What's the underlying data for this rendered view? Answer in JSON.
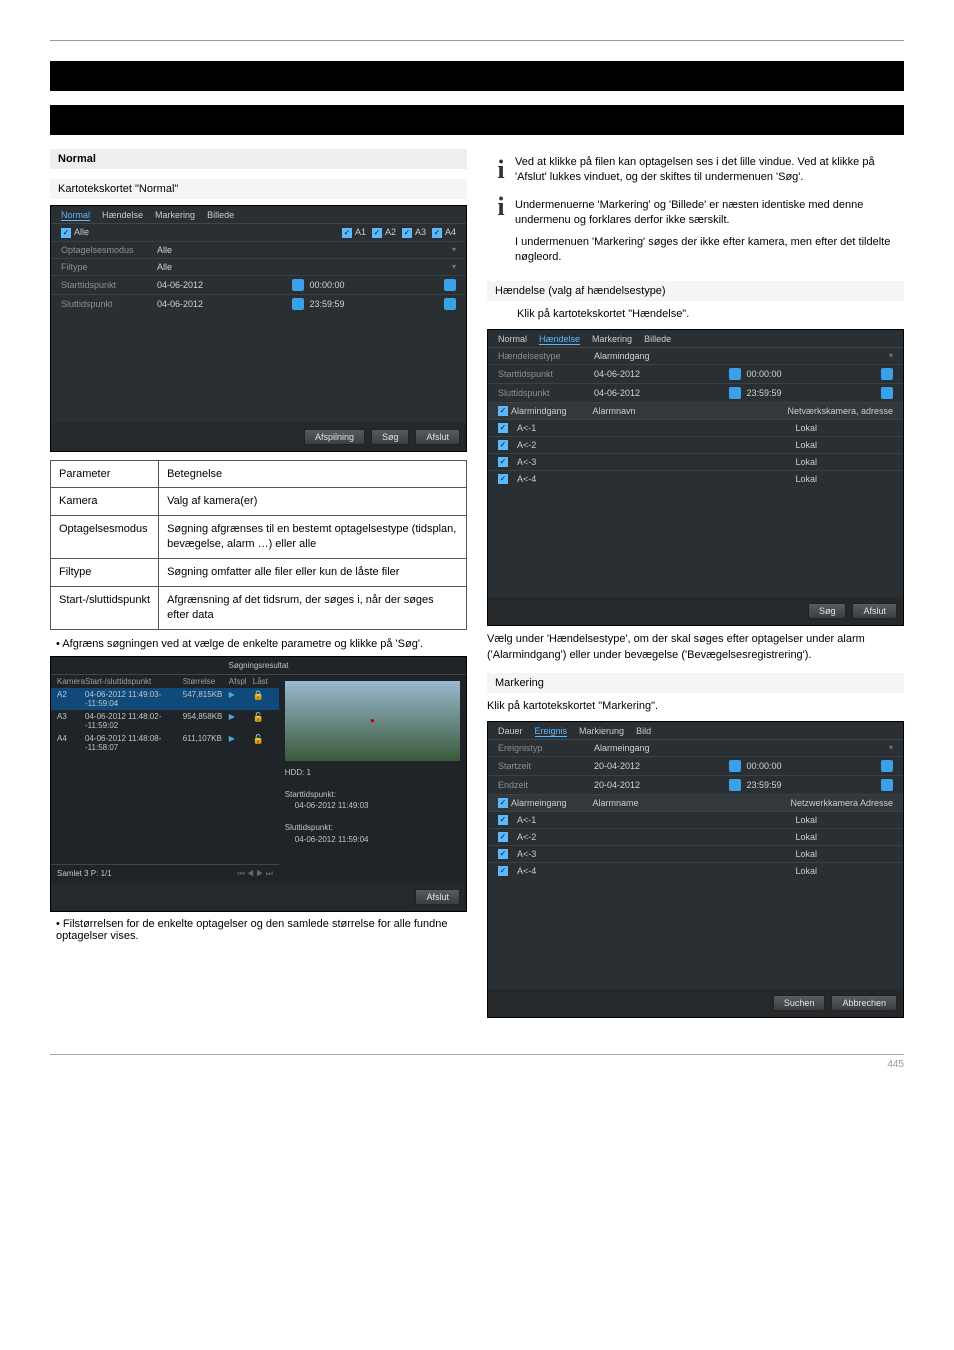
{
  "black_bars": {
    "spacer": " "
  },
  "left": {
    "section_title": "Normal",
    "sub1": "Kartotekskortet \"Normal\"",
    "panel1": {
      "tabs": {
        "t1": "Normal",
        "t2": "Hændelse",
        "t3": "Markering",
        "t4": "Billede"
      },
      "chk_all": "Alle",
      "ch": {
        "a1": "A1",
        "a2": "A2",
        "a3": "A3",
        "a4": "A4"
      },
      "rows": {
        "rec_mode_label": "Optagelsesmodus",
        "rec_mode_val": "Alle",
        "filetype_label": "Filtype",
        "filetype_val": "Alle",
        "start_label": "Starttidspunkt",
        "start_date": "04-06-2012",
        "start_time": "00:00:00",
        "end_label": "Sluttidspunkt",
        "end_date": "04-06-2012",
        "end_time": "23:59:59"
      },
      "btn_play": "Afspilning",
      "btn_search": "Søg",
      "btn_close": "Afslut"
    },
    "param_table": {
      "r1n": "Parameter",
      "r1v": "Betegnelse",
      "r2n": "Kamera",
      "r2v": "Valg af kamera(er)",
      "r3n": "Optagelsesmodus",
      "r3v": "Søgning afgrænses til en bestemt optagelsestype (tidsplan, bevægelse, alarm …) eller alle",
      "r4n": "Filtype",
      "r4v": "Søgning omfatter alle filer eller kun de låste filer",
      "r5n": "Start-/sluttidspunkt",
      "r5v": "Afgrænsning af det tidsrum, der søges i, når der søges efter data"
    },
    "bullet1": "Afgræns søgningen ved at vælge de enkelte parametre og klikke på 'Søg'.",
    "sr": {
      "title": "Søgningsresultat",
      "head": {
        "cam": "Kamera",
        "time": "Start-/sluttidspunkt",
        "size": "Størrelse",
        "play": "Afspl",
        "lock": "Låst"
      },
      "rows": [
        {
          "cam": "A2",
          "time": "04-06-2012 11:49:03--11:59:04",
          "size": "547,815KB"
        },
        {
          "cam": "A3",
          "time": "04-06-2012 11:48:02--11:59:02",
          "size": "954,858KB"
        },
        {
          "cam": "A4",
          "time": "04-06-2012 11:48:08--11:58:07",
          "size": "611,107KB"
        }
      ],
      "hdd": "HDD: 1",
      "st_lbl": "Starttidspunkt:",
      "st_val": "04-06-2012 11:49:03",
      "et_lbl": "Sluttidspunkt:",
      "et_val": "04-06-2012 11:59:04",
      "total": "Samlet 3 P: 1/1",
      "btn_close": "Afslut"
    },
    "bullet2": "Filstørrelsen for de enkelte optagelser og den samlede størrelse for alle fundne optagelser vises."
  },
  "right": {
    "info1a": "Ved at klikke på filen kan optagelsen ses i det lille vindue. Ved at klikke på 'Afslut' lukkes vinduet, og der skiftes til undermenuen 'Søg'.",
    "info2a": "Undermenuerne 'Markering' og 'Billede' er næsten identiske med denne undermenu og forklares derfor ikke særskilt.",
    "info2b": "I undermenuen 'Markering' søges der ikke efter kamera, men efter det tildelte nøgleord.",
    "sub1": "Hændelse (valg af hændelsestype)",
    "text1": "Klik på kartotekskortet \"Hændelse\".",
    "panel1": {
      "tabs": {
        "t1": "Normal",
        "t2": "Hændelse",
        "t3": "Markering",
        "t4": "Billede"
      },
      "rows": {
        "evtype_label": "Hændelsestype",
        "evtype_val": "Alarmindgang",
        "start_label": "Starttidspunkt",
        "start_date": "04-06-2012",
        "start_time": "00:00:00",
        "end_label": "Sluttidspunkt",
        "end_date": "04-06-2012",
        "end_time": "23:59:59"
      },
      "alarm_hdr": "Alarmindgang",
      "alarm_name": "Alarmnavn",
      "alarm_addr": "Netværkskamera, adresse",
      "items": [
        {
          "id": "A<-1",
          "val": "Lokal"
        },
        {
          "id": "A<-2",
          "val": "Lokal"
        },
        {
          "id": "A<-3",
          "val": "Lokal"
        },
        {
          "id": "A<-4",
          "val": "Lokal"
        }
      ],
      "btn_search": "Søg",
      "btn_close": "Afslut"
    },
    "text2": "Vælg under 'Hændelsestype', om der skal søges efter optagelser under alarm ('Alarmindgang') eller under bevægelse ('Bevægelsesregistrering').",
    "sub2": "Markering",
    "text3": "Klik på kartotekskortet \"Markering\".",
    "panel2": {
      "tabs": {
        "t1": "Dauer",
        "t2": "Ereignis",
        "t3": "Markierung",
        "t4": "Bild"
      },
      "rows": {
        "evtype_label": "Ereignistyp",
        "evtype_val": "Alarmeingang",
        "start_label": "Startzeit",
        "start_date": "20-04-2012",
        "start_time": "00:00:00",
        "end_label": "Endzeit",
        "end_date": "20-04-2012",
        "end_time": "23:59:59"
      },
      "alarm_hdr": "Alarmeingang",
      "alarm_name": "Alarmname",
      "alarm_addr": "Netzwerkkamera Adresse",
      "items": [
        {
          "id": "A<-1",
          "val": "Lokal"
        },
        {
          "id": "A<-2",
          "val": "Lokal"
        },
        {
          "id": "A<-3",
          "val": "Lokal"
        },
        {
          "id": "A<-4",
          "val": "Lokal"
        }
      ],
      "btn_search": "Suchen",
      "btn_close": "Abbrechen"
    }
  },
  "footer": "445"
}
